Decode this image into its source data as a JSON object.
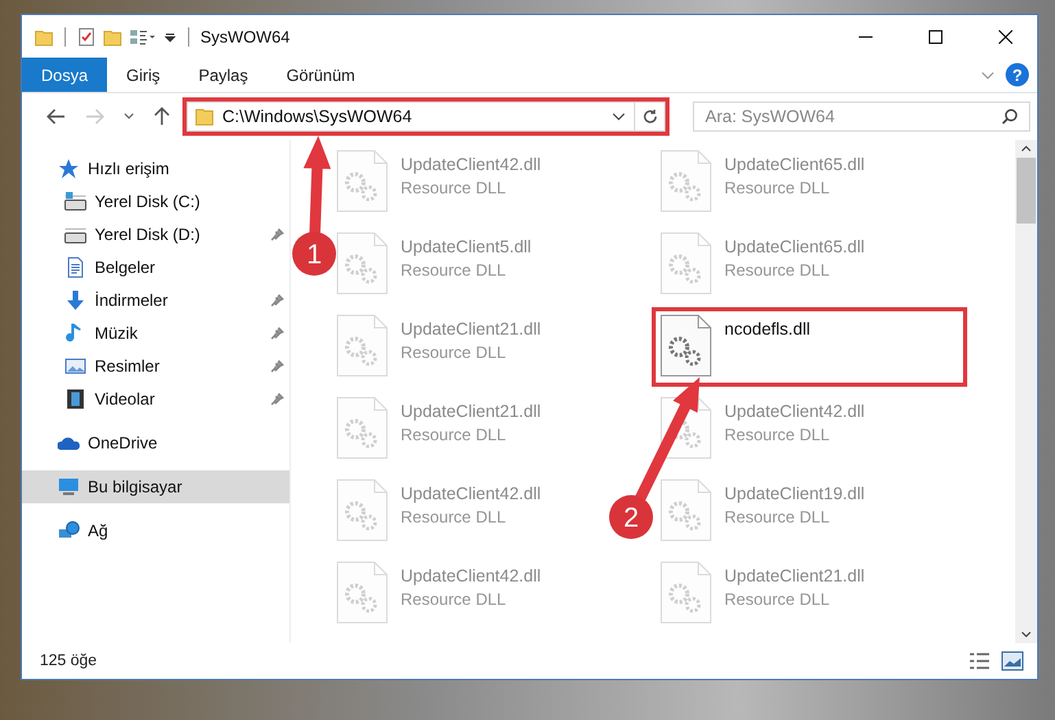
{
  "window": {
    "title": "SysWOW64"
  },
  "ribbon_tabs": [
    {
      "label": "Dosya",
      "selected": true
    },
    {
      "label": "Giriş",
      "selected": false
    },
    {
      "label": "Paylaş",
      "selected": false
    },
    {
      "label": "Görünüm",
      "selected": false
    }
  ],
  "help_button": {
    "label": "?"
  },
  "address_bar": {
    "path": "C:\\Windows\\SysWOW64",
    "highlighted": true
  },
  "search": {
    "placeholder": "Ara: SysWOW64"
  },
  "sidebar": {
    "items": [
      {
        "label": "Hızlı erişim",
        "kind": "star",
        "selected": false,
        "children": [
          {
            "label": "Yerel Disk (C:)",
            "kind": "drive-c",
            "pinned": false,
            "selected": false
          },
          {
            "label": "Yerel Disk (D:)",
            "kind": "drive",
            "pinned": true,
            "selected": false
          },
          {
            "label": "Belgeler",
            "kind": "document",
            "pinned": false,
            "selected": false
          },
          {
            "label": "İndirmeler",
            "kind": "download",
            "pinned": true,
            "selected": false
          },
          {
            "label": "Müzik",
            "kind": "music",
            "pinned": true,
            "selected": false
          },
          {
            "label": "Resimler",
            "kind": "pictures",
            "pinned": true,
            "selected": false
          },
          {
            "label": "Videolar",
            "kind": "videos",
            "pinned": true,
            "selected": false
          }
        ]
      },
      {
        "label": "OneDrive",
        "kind": "cloud",
        "selected": false
      },
      {
        "label": "Bu bilgisayar",
        "kind": "computer",
        "selected": true
      },
      {
        "label": "Ağ",
        "kind": "network",
        "selected": false
      }
    ]
  },
  "files": [
    {
      "name": "UpdateClient42.dll",
      "type": "Resource DLL",
      "faded": true,
      "highlighted": false
    },
    {
      "name": "UpdateClient65.dll",
      "type": "Resource DLL",
      "faded": true,
      "highlighted": false
    },
    {
      "name": "UpdateClient5.dll",
      "type": "Resource DLL",
      "faded": true,
      "highlighted": false
    },
    {
      "name": "UpdateClient65.dll",
      "type": "Resource DLL",
      "faded": true,
      "highlighted": false
    },
    {
      "name": "UpdateClient21.dll",
      "type": "Resource DLL",
      "faded": true,
      "highlighted": false
    },
    {
      "name": "ncodefls.dll",
      "faded": false,
      "highlighted": true
    },
    {
      "name": "UpdateClient21.dll",
      "type": "Resource DLL",
      "faded": true,
      "highlighted": false
    },
    {
      "name": "UpdateClient42.dll",
      "type": "Resource DLL",
      "faded": true,
      "highlighted": false
    },
    {
      "name": "UpdateClient42.dll",
      "type": "Resource DLL",
      "faded": true,
      "highlighted": false
    },
    {
      "name": "UpdateClient19.dll",
      "type": "Resource DLL",
      "faded": true,
      "highlighted": false
    },
    {
      "name": "UpdateClient42.dll",
      "type": "Resource DLL",
      "faded": true,
      "highlighted": false
    },
    {
      "name": "UpdateClient21.dll",
      "type": "Resource DLL",
      "faded": true,
      "highlighted": false
    }
  ],
  "status_bar": {
    "item_count": "125 öğe"
  },
  "callouts": [
    {
      "number": "1"
    },
    {
      "number": "2"
    }
  ]
}
